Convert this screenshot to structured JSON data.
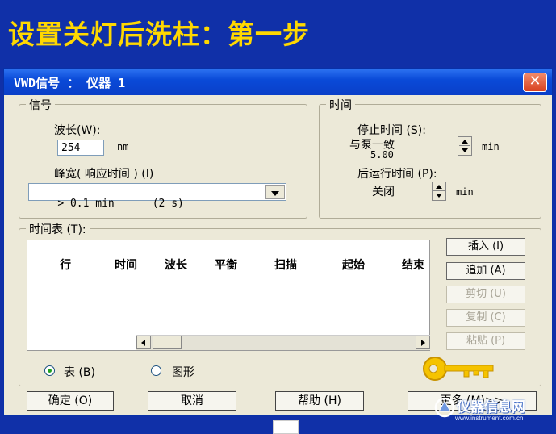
{
  "slide": {
    "title": "设置关灯后洗柱：第一步"
  },
  "dialog": {
    "title": "VWD信号 ： 仪器 1",
    "close_glyph": "✕",
    "signal": {
      "group_label": "信号",
      "wavelength_label": "波长(W):",
      "wavelength_value": "254",
      "wavelength_unit": "nm",
      "peakwidth_label": "峰宽( 响应时间 ) (I)",
      "peakwidth_value": "> 0.1 min      (2 s)"
    },
    "time": {
      "group_label": "时间",
      "stop_label": "停止时间 (S):",
      "stop_value_line1": "与泵一致",
      "stop_value_line2": "5.00",
      "stop_unit": "min",
      "post_label": "后运行时间 (P):",
      "post_value": "关闭",
      "post_unit": "min"
    },
    "timetable": {
      "group_label": "时间表 (T):",
      "columns": [
        "行",
        "时间",
        "波长",
        "平衡",
        "扫描",
        "起始",
        "结束"
      ]
    },
    "side_buttons": [
      {
        "label": "插入 (I)",
        "enabled": true
      },
      {
        "label": "追加 (A)",
        "enabled": true
      },
      {
        "label": "剪切 (U)",
        "enabled": false
      },
      {
        "label": "复制 (C)",
        "enabled": false
      },
      {
        "label": "粘贴 (P)",
        "enabled": false
      }
    ],
    "view": {
      "table_label": "表 (B)",
      "graph_label": "图形",
      "selected": "table"
    },
    "bottom_buttons": {
      "ok": "确定 (O)",
      "cancel": "取消",
      "help": "帮助 (H)",
      "more": "更多 (M)>>"
    }
  },
  "watermark": {
    "text": "仪器信息网",
    "url": "www.instrument.com.cn"
  },
  "colors": {
    "background": "#1030a8",
    "title": "#ffd800",
    "dialog": "#ece9d8",
    "titlebar": "#0a4ad8",
    "key": "#f5c300"
  }
}
